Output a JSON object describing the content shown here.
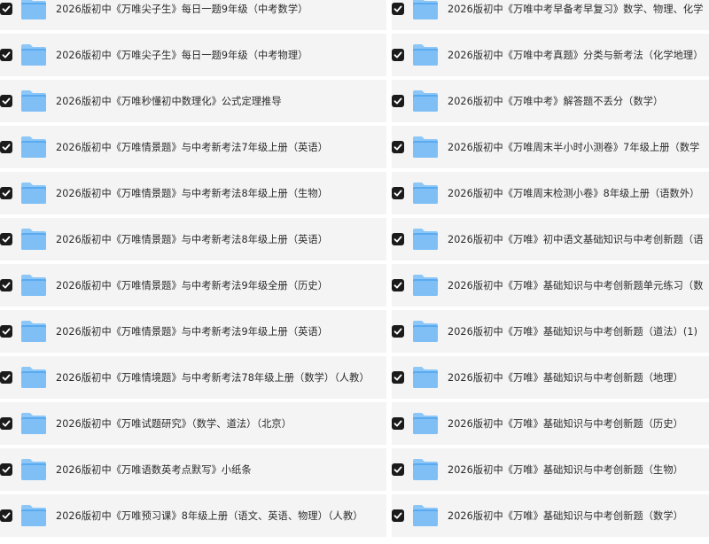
{
  "files": {
    "left": [
      {
        "name": "2026版初中《万唯尖子生》每日一题9年级（中考数学）",
        "checked": true
      },
      {
        "name": "2026版初中《万唯尖子生》每日一题9年级（中考物理）",
        "checked": true
      },
      {
        "name": "2026版初中《万唯秒懂初中数理化》公式定理推导",
        "checked": true
      },
      {
        "name": "2026版初中《万唯情景题》与中考新考法7年级上册（英语）",
        "checked": true
      },
      {
        "name": "2026版初中《万唯情景题》与中考新考法8年级上册（生物）",
        "checked": true
      },
      {
        "name": "2026版初中《万唯情景题》与中考新考法8年级上册（英语）",
        "checked": true
      },
      {
        "name": "2026版初中《万唯情景题》与中考新考法9年级全册（历史）",
        "checked": true
      },
      {
        "name": "2026版初中《万唯情景题》与中考新考法9年级上册（英语）",
        "checked": true
      },
      {
        "name": "2026版初中《万唯情境题》与中考新考法78年级上册（数学）（人教）",
        "checked": true
      },
      {
        "name": "2026版初中《万唯试题研究》（数学、道法）（北京）",
        "checked": true
      },
      {
        "name": "2026版初中《万唯语数英考点默写》小纸条",
        "checked": true
      },
      {
        "name": "2026版初中《万唯预习课》8年级上册（语文、英语、物理）（人教）",
        "checked": true
      }
    ],
    "right": [
      {
        "name": "2026版初中《万唯中考早备考早复习》数学、物理、化学",
        "checked": true
      },
      {
        "name": "2026版初中《万唯中考真题》分类与新考法（化学地理）",
        "checked": true
      },
      {
        "name": "2026版初中《万唯中考》解答题不丢分（数学）",
        "checked": true
      },
      {
        "name": "2026版初中《万唯周末半小时小测卷》7年级上册（数学",
        "checked": true
      },
      {
        "name": "2026版初中《万唯周末检测小卷》8年级上册（语数外）",
        "checked": true
      },
      {
        "name": "2026版初中《万唯》初中语文基础知识与中考创新题（语",
        "checked": true
      },
      {
        "name": "2026版初中《万唯》基础知识与中考创新题单元练习（数",
        "checked": true
      },
      {
        "name": "2026版初中《万唯》基础知识与中考创新题（道法）(1)",
        "checked": true
      },
      {
        "name": "2026版初中《万唯》基础知识与中考创新题（地理）",
        "checked": true
      },
      {
        "name": "2026版初中《万唯》基础知识与中考创新题（历史）",
        "checked": true
      },
      {
        "name": "2026版初中《万唯》基础知识与中考创新题（生物）",
        "checked": true
      },
      {
        "name": "2026版初中《万唯》基础知识与中考创新题（数学）",
        "checked": true
      }
    ]
  },
  "icons": {
    "checkbox": "checkbox-checked-icon",
    "folder": "folder-icon"
  },
  "colors": {
    "checkbox": "#1b1b1b",
    "folder_front": "#4ea3ec",
    "folder_back": "#8cc7f7",
    "row_bg": "#f4f4f4"
  }
}
